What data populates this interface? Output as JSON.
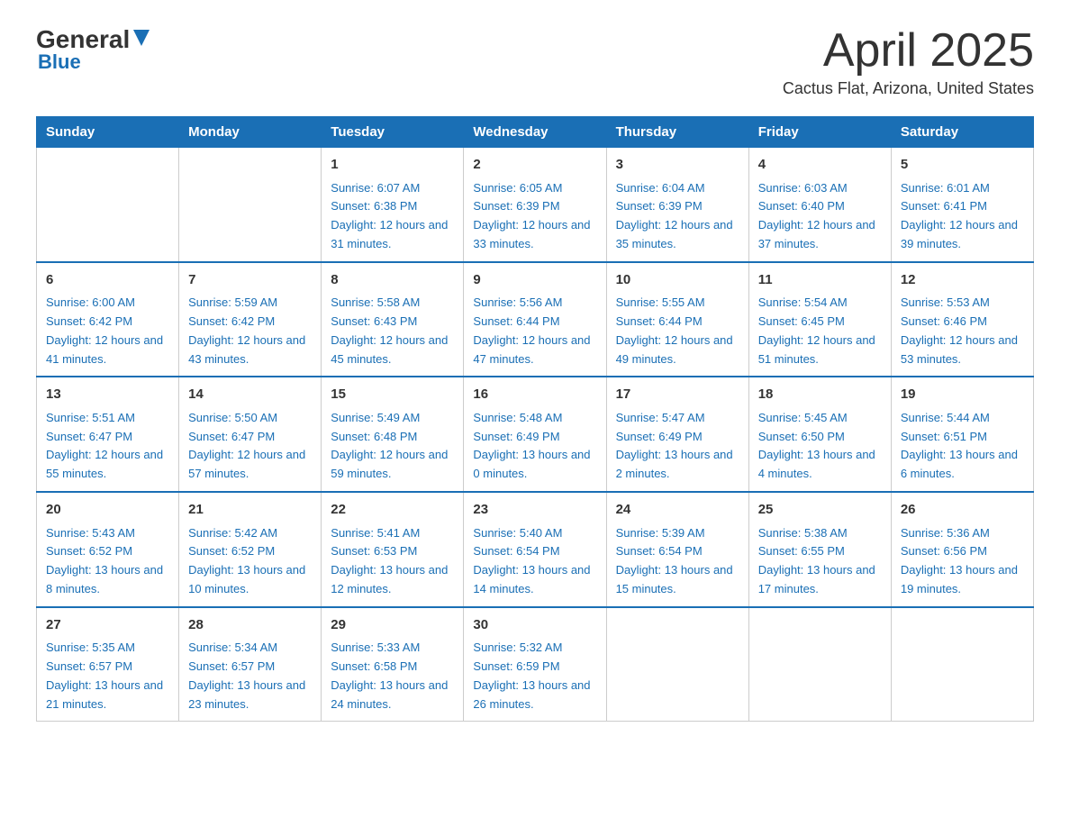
{
  "header": {
    "logo_general": "General",
    "logo_blue": "Blue",
    "month_title": "April 2025",
    "location": "Cactus Flat, Arizona, United States"
  },
  "days_of_week": [
    "Sunday",
    "Monday",
    "Tuesday",
    "Wednesday",
    "Thursday",
    "Friday",
    "Saturday"
  ],
  "weeks": [
    [
      {
        "day": "",
        "sunrise": "",
        "sunset": "",
        "daylight": ""
      },
      {
        "day": "",
        "sunrise": "",
        "sunset": "",
        "daylight": ""
      },
      {
        "day": "1",
        "sunrise": "Sunrise: 6:07 AM",
        "sunset": "Sunset: 6:38 PM",
        "daylight": "Daylight: 12 hours and 31 minutes."
      },
      {
        "day": "2",
        "sunrise": "Sunrise: 6:05 AM",
        "sunset": "Sunset: 6:39 PM",
        "daylight": "Daylight: 12 hours and 33 minutes."
      },
      {
        "day": "3",
        "sunrise": "Sunrise: 6:04 AM",
        "sunset": "Sunset: 6:39 PM",
        "daylight": "Daylight: 12 hours and 35 minutes."
      },
      {
        "day": "4",
        "sunrise": "Sunrise: 6:03 AM",
        "sunset": "Sunset: 6:40 PM",
        "daylight": "Daylight: 12 hours and 37 minutes."
      },
      {
        "day": "5",
        "sunrise": "Sunrise: 6:01 AM",
        "sunset": "Sunset: 6:41 PM",
        "daylight": "Daylight: 12 hours and 39 minutes."
      }
    ],
    [
      {
        "day": "6",
        "sunrise": "Sunrise: 6:00 AM",
        "sunset": "Sunset: 6:42 PM",
        "daylight": "Daylight: 12 hours and 41 minutes."
      },
      {
        "day": "7",
        "sunrise": "Sunrise: 5:59 AM",
        "sunset": "Sunset: 6:42 PM",
        "daylight": "Daylight: 12 hours and 43 minutes."
      },
      {
        "day": "8",
        "sunrise": "Sunrise: 5:58 AM",
        "sunset": "Sunset: 6:43 PM",
        "daylight": "Daylight: 12 hours and 45 minutes."
      },
      {
        "day": "9",
        "sunrise": "Sunrise: 5:56 AM",
        "sunset": "Sunset: 6:44 PM",
        "daylight": "Daylight: 12 hours and 47 minutes."
      },
      {
        "day": "10",
        "sunrise": "Sunrise: 5:55 AM",
        "sunset": "Sunset: 6:44 PM",
        "daylight": "Daylight: 12 hours and 49 minutes."
      },
      {
        "day": "11",
        "sunrise": "Sunrise: 5:54 AM",
        "sunset": "Sunset: 6:45 PM",
        "daylight": "Daylight: 12 hours and 51 minutes."
      },
      {
        "day": "12",
        "sunrise": "Sunrise: 5:53 AM",
        "sunset": "Sunset: 6:46 PM",
        "daylight": "Daylight: 12 hours and 53 minutes."
      }
    ],
    [
      {
        "day": "13",
        "sunrise": "Sunrise: 5:51 AM",
        "sunset": "Sunset: 6:47 PM",
        "daylight": "Daylight: 12 hours and 55 minutes."
      },
      {
        "day": "14",
        "sunrise": "Sunrise: 5:50 AM",
        "sunset": "Sunset: 6:47 PM",
        "daylight": "Daylight: 12 hours and 57 minutes."
      },
      {
        "day": "15",
        "sunrise": "Sunrise: 5:49 AM",
        "sunset": "Sunset: 6:48 PM",
        "daylight": "Daylight: 12 hours and 59 minutes."
      },
      {
        "day": "16",
        "sunrise": "Sunrise: 5:48 AM",
        "sunset": "Sunset: 6:49 PM",
        "daylight": "Daylight: 13 hours and 0 minutes."
      },
      {
        "day": "17",
        "sunrise": "Sunrise: 5:47 AM",
        "sunset": "Sunset: 6:49 PM",
        "daylight": "Daylight: 13 hours and 2 minutes."
      },
      {
        "day": "18",
        "sunrise": "Sunrise: 5:45 AM",
        "sunset": "Sunset: 6:50 PM",
        "daylight": "Daylight: 13 hours and 4 minutes."
      },
      {
        "day": "19",
        "sunrise": "Sunrise: 5:44 AM",
        "sunset": "Sunset: 6:51 PM",
        "daylight": "Daylight: 13 hours and 6 minutes."
      }
    ],
    [
      {
        "day": "20",
        "sunrise": "Sunrise: 5:43 AM",
        "sunset": "Sunset: 6:52 PM",
        "daylight": "Daylight: 13 hours and 8 minutes."
      },
      {
        "day": "21",
        "sunrise": "Sunrise: 5:42 AM",
        "sunset": "Sunset: 6:52 PM",
        "daylight": "Daylight: 13 hours and 10 minutes."
      },
      {
        "day": "22",
        "sunrise": "Sunrise: 5:41 AM",
        "sunset": "Sunset: 6:53 PM",
        "daylight": "Daylight: 13 hours and 12 minutes."
      },
      {
        "day": "23",
        "sunrise": "Sunrise: 5:40 AM",
        "sunset": "Sunset: 6:54 PM",
        "daylight": "Daylight: 13 hours and 14 minutes."
      },
      {
        "day": "24",
        "sunrise": "Sunrise: 5:39 AM",
        "sunset": "Sunset: 6:54 PM",
        "daylight": "Daylight: 13 hours and 15 minutes."
      },
      {
        "day": "25",
        "sunrise": "Sunrise: 5:38 AM",
        "sunset": "Sunset: 6:55 PM",
        "daylight": "Daylight: 13 hours and 17 minutes."
      },
      {
        "day": "26",
        "sunrise": "Sunrise: 5:36 AM",
        "sunset": "Sunset: 6:56 PM",
        "daylight": "Daylight: 13 hours and 19 minutes."
      }
    ],
    [
      {
        "day": "27",
        "sunrise": "Sunrise: 5:35 AM",
        "sunset": "Sunset: 6:57 PM",
        "daylight": "Daylight: 13 hours and 21 minutes."
      },
      {
        "day": "28",
        "sunrise": "Sunrise: 5:34 AM",
        "sunset": "Sunset: 6:57 PM",
        "daylight": "Daylight: 13 hours and 23 minutes."
      },
      {
        "day": "29",
        "sunrise": "Sunrise: 5:33 AM",
        "sunset": "Sunset: 6:58 PM",
        "daylight": "Daylight: 13 hours and 24 minutes."
      },
      {
        "day": "30",
        "sunrise": "Sunrise: 5:32 AM",
        "sunset": "Sunset: 6:59 PM",
        "daylight": "Daylight: 13 hours and 26 minutes."
      },
      {
        "day": "",
        "sunrise": "",
        "sunset": "",
        "daylight": ""
      },
      {
        "day": "",
        "sunrise": "",
        "sunset": "",
        "daylight": ""
      },
      {
        "day": "",
        "sunrise": "",
        "sunset": "",
        "daylight": ""
      }
    ]
  ]
}
